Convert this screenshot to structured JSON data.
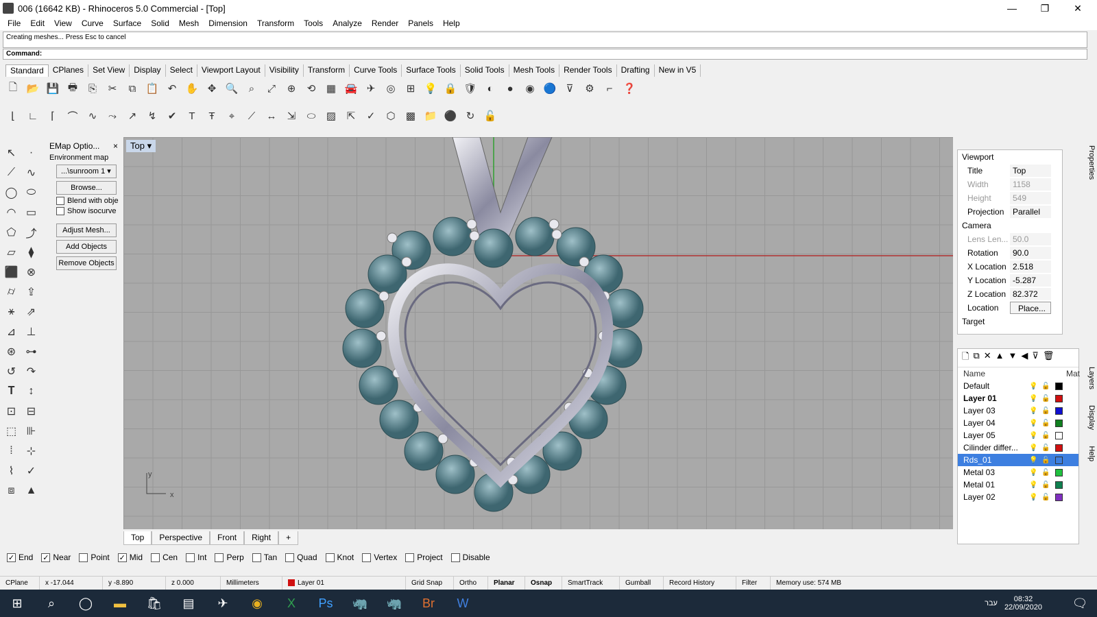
{
  "window": {
    "title": "006 (16642 KB) - Rhinoceros 5.0 Commercial - [Top]",
    "min": "—",
    "max": "❐",
    "close": "✕"
  },
  "menu": [
    "File",
    "Edit",
    "View",
    "Curve",
    "Surface",
    "Solid",
    "Mesh",
    "Dimension",
    "Transform",
    "Tools",
    "Analyze",
    "Render",
    "Panels",
    "Help"
  ],
  "command": {
    "history": "Creating meshes... Press Esc to cancel",
    "prompt": "Command:"
  },
  "toolbar_tabs": [
    "Standard",
    "CPlanes",
    "Set View",
    "Display",
    "Select",
    "Viewport Layout",
    "Visibility",
    "Transform",
    "Curve Tools",
    "Surface Tools",
    "Solid Tools",
    "Mesh Tools",
    "Render Tools",
    "Drafting",
    "New in V5"
  ],
  "emap": {
    "title": "EMap Optio...",
    "close": "×",
    "env_label": "Environment map",
    "env_value": "...\\sunroom 1",
    "browse": "Browse...",
    "blend": "Blend with obje",
    "isocurve": "Show isocurve",
    "adjust": "Adjust Mesh...",
    "add": "Add Objects",
    "remove": "Remove Objects"
  },
  "viewport": {
    "label": "Top",
    "axis_y": "y",
    "axis_x": "x"
  },
  "viewport_tabs": [
    "Top",
    "Perspective",
    "Front",
    "Right",
    "+"
  ],
  "properties": {
    "section_viewport": "Viewport",
    "title_k": "Title",
    "title_v": "Top",
    "width_k": "Width",
    "width_v": "1158",
    "height_k": "Height",
    "height_v": "549",
    "projection_k": "Projection",
    "projection_v": "Parallel",
    "section_camera": "Camera",
    "lens_k": "Lens Len...",
    "lens_v": "50.0",
    "rotation_k": "Rotation",
    "rotation_v": "90.0",
    "xloc_k": "X Location",
    "xloc_v": "2.518",
    "yloc_k": "Y Location",
    "yloc_v": "-5.287",
    "zloc_k": "Z Location",
    "zloc_v": "82.372",
    "loc_k": "Location",
    "loc_v": "Place...",
    "section_target": "Target"
  },
  "layers": {
    "header_name": "Name",
    "header_mat": "Mat",
    "rows": [
      {
        "name": "Default",
        "color": "#000000"
      },
      {
        "name": "Layer 01",
        "color": "#d01010"
      },
      {
        "name": "Layer 03",
        "color": "#1010d0"
      },
      {
        "name": "Layer 04",
        "color": "#108020"
      },
      {
        "name": "Layer 05",
        "color": "#ffffff"
      },
      {
        "name": "Cilinder differ...",
        "color": "#d01010"
      },
      {
        "name": "Rds_01",
        "color": "#3d7fe0"
      },
      {
        "name": "Metal 03",
        "color": "#20c040"
      },
      {
        "name": "Metal 01",
        "color": "#108050"
      },
      {
        "name": "Layer 02",
        "color": "#8030c0"
      }
    ]
  },
  "side_tabs": [
    "Properties",
    "Layers",
    "Display",
    "Help"
  ],
  "osnap": [
    {
      "label": "End",
      "checked": true
    },
    {
      "label": "Near",
      "checked": true
    },
    {
      "label": "Point",
      "checked": false
    },
    {
      "label": "Mid",
      "checked": true
    },
    {
      "label": "Cen",
      "checked": false
    },
    {
      "label": "Int",
      "checked": false
    },
    {
      "label": "Perp",
      "checked": false
    },
    {
      "label": "Tan",
      "checked": false
    },
    {
      "label": "Quad",
      "checked": false
    },
    {
      "label": "Knot",
      "checked": false
    },
    {
      "label": "Vertex",
      "checked": false
    },
    {
      "label": "Project",
      "checked": false
    },
    {
      "label": "Disable",
      "checked": false
    }
  ],
  "status": {
    "cplane": "CPlane",
    "x": "x -17.044",
    "y": "y -8.890",
    "z": "z 0.000",
    "units": "Millimeters",
    "layer": "Layer 01",
    "gridsnap": "Grid Snap",
    "ortho": "Ortho",
    "planar": "Planar",
    "osnap": "Osnap",
    "smarttrack": "SmartTrack",
    "gumball": "Gumball",
    "history": "Record History",
    "filter": "Filter",
    "memory": "Memory use: 574 MB"
  },
  "taskbar": {
    "time": "08:32",
    "date": "22/09/2020",
    "lang": "עבר"
  }
}
